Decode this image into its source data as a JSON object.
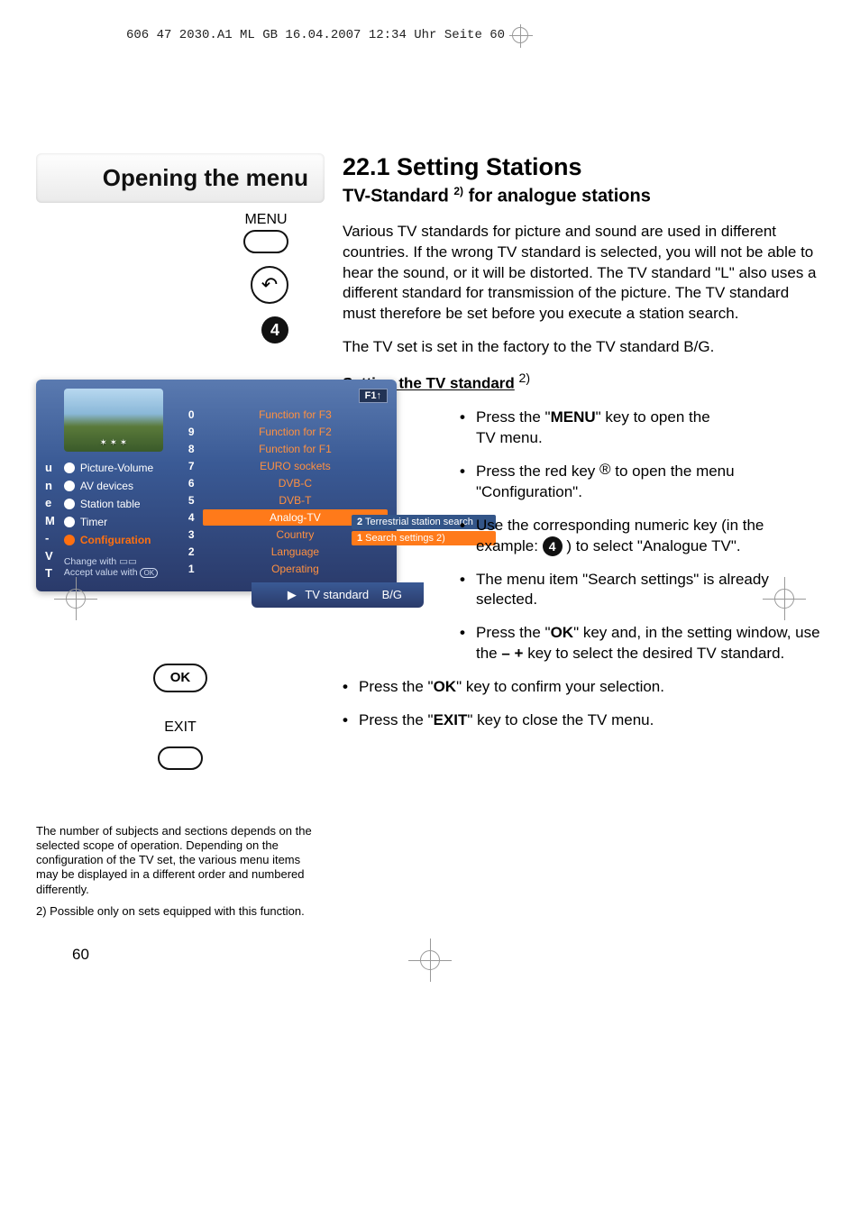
{
  "header_line": "606 47 2030.A1  ML GB  16.04.2007  12:34 Uhr  Seite 60",
  "left_heading": "Opening the menu",
  "remote": {
    "menu": "MENU",
    "num": "4",
    "ok": "OK",
    "exit": "EXIT"
  },
  "section": {
    "title": "22.1 Setting Stations",
    "subtitle_prefix": "TV-Standard ",
    "subtitle_sup": "2)",
    "subtitle_suffix": " for analogue stations"
  },
  "para1": "Various TV standards for picture and sound are used in different countries. If the wrong TV standard is selected, you will not be able to hear the sound, or it will be distorted. The TV standard \"L\" also uses a different standard for transmission of the picture. The TV standard must therefore be set before you execute a station search.",
  "para2": "The TV set is set in the factory to the TV standard B/G.",
  "sub_heading": "Setting the TV standard",
  "sub_heading_sup": "2)",
  "bullets_right": [
    "Press the \"MENU\" key to open the TV menu.",
    "Press the red key ® to open the menu \"Configuration\".",
    "Use the corresponding numeric key (in the example: 4 ) to select \"Analogue TV\".",
    "The menu item \"Search settings\" is already selected.",
    "Press the \"OK\" key and, in the setting window, use the – + key to select the desired TV standard."
  ],
  "bullets_lower": [
    "Press the \"OK\" key to confirm your selection.",
    "Press the \"EXIT\" key to close the TV menu."
  ],
  "tv_menu": {
    "stars": "✶ ✶ ✶",
    "letters": [
      "T",
      "V",
      "-",
      "M",
      "e",
      "n",
      "u"
    ],
    "sidebar": [
      {
        "label": "Picture-Volume",
        "active": false
      },
      {
        "label": "AV devices",
        "active": false
      },
      {
        "label": "Station table",
        "active": false
      },
      {
        "label": "Timer",
        "active": false
      },
      {
        "label": "Configuration",
        "active": true
      }
    ],
    "f1": "F1↑",
    "rows": [
      {
        "num": "0",
        "label": "Function for F3",
        "hl": false
      },
      {
        "num": "9",
        "label": "Function for F2",
        "hl": false
      },
      {
        "num": "8",
        "label": "Function for F1",
        "hl": false
      },
      {
        "num": "7",
        "label": "EURO sockets",
        "hl": false
      },
      {
        "num": "6",
        "label": "DVB-C",
        "hl": false
      },
      {
        "num": "5",
        "label": "DVB-T",
        "hl": false
      },
      {
        "num": "4",
        "label": "Analog-TV",
        "hl": true
      },
      {
        "num": "3",
        "label": "Country",
        "hl": false
      },
      {
        "num": "2",
        "label": "Language",
        "hl": false
      },
      {
        "num": "1",
        "label": "Operating",
        "hl": false
      }
    ],
    "hint1": "Change with",
    "hint2": "Accept value with",
    "search_tabs": [
      {
        "num": "2",
        "label": "Terrestrial station search",
        "cls": "alt"
      },
      {
        "num": "1",
        "label": "Search settings 2)",
        "cls": ""
      }
    ],
    "std_label": "TV standard",
    "std_value": "B/G"
  },
  "footnote1": "The number of subjects and sections depends on the selected scope of operation. Depending on the configuration of the TV set, the various menu items may be displayed in a different order and numbered differently.",
  "footnote2": "2) Possible only on sets equipped with this function.",
  "page_num": "60"
}
